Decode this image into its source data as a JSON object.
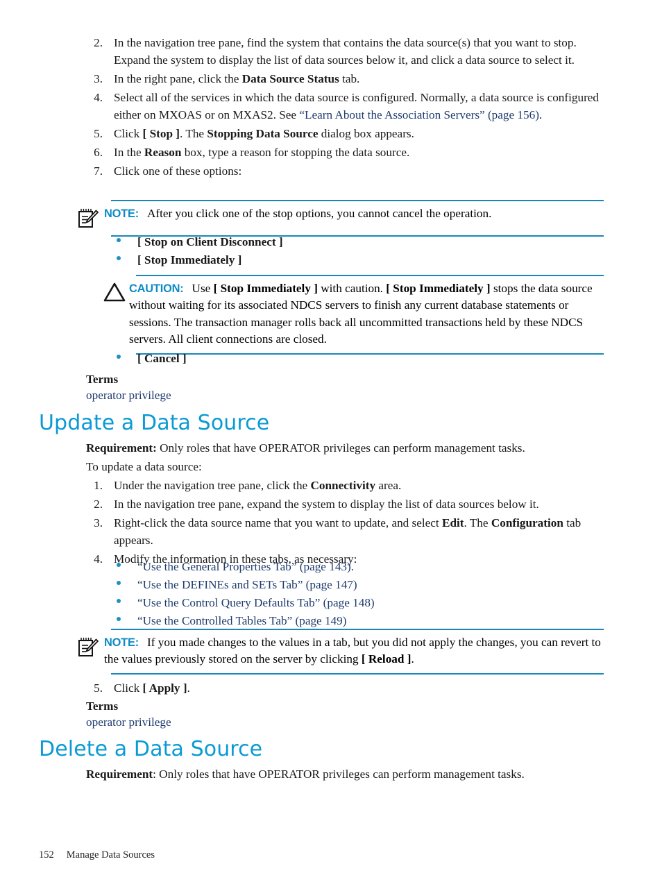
{
  "document": {
    "footer": {
      "page_number": "152",
      "chapter_title": "Manage Data Sources"
    }
  },
  "colors": {
    "heading": "#0b9ad4",
    "admonition_label": "#0c8bc6",
    "rule": "#1b87b8",
    "bullet": "#1c8fc4",
    "link": "#1f3c6e"
  },
  "stop_procedure": {
    "steps": [
      {
        "num": "2.",
        "parts": [
          {
            "text": "In the navigation tree pane, find the system that contains the data source(s) that you want to stop. Expand the system to display the list of data sources below it, and click a data source to select it.",
            "style": "plain"
          }
        ]
      },
      {
        "num": "3.",
        "parts": [
          {
            "text": "In the right pane, click the ",
            "style": "plain"
          },
          {
            "text": "Data Source Status",
            "style": "bold"
          },
          {
            "text": " tab.",
            "style": "plain"
          }
        ]
      },
      {
        "num": "4.",
        "parts": [
          {
            "text": "Select all of the services in which the data source is configured. Normally, a data source is configured either on MXOAS or on MXAS2. See ",
            "style": "plain"
          },
          {
            "text": "“Learn About the Association Servers” (page 156)",
            "style": "link"
          },
          {
            "text": ".",
            "style": "plain"
          }
        ]
      },
      {
        "num": "5.",
        "parts": [
          {
            "text": "Click ",
            "style": "plain"
          },
          {
            "text": "[ Stop ]",
            "style": "bold"
          },
          {
            "text": ". The ",
            "style": "plain"
          },
          {
            "text": "Stopping Data Source",
            "style": "bold"
          },
          {
            "text": " dialog box appears.",
            "style": "plain"
          }
        ]
      },
      {
        "num": "6.",
        "parts": [
          {
            "text": "In the ",
            "style": "plain"
          },
          {
            "text": "Reason",
            "style": "bold"
          },
          {
            "text": " box, type a reason for stopping the data source.",
            "style": "plain"
          }
        ]
      },
      {
        "num": "7.",
        "parts": [
          {
            "text": "Click one of these options:",
            "style": "plain"
          }
        ]
      }
    ],
    "note": {
      "icon": "note-pencil-icon",
      "label": "NOTE:",
      "text": "After you click one of the stop options, you cannot cancel the operation."
    },
    "stop_options": [
      "[ Stop on Client Disconnect ]",
      "[ Stop Immediately ]"
    ],
    "caution": {
      "icon": "caution-triangle-icon",
      "label": "CAUTION:",
      "parts": [
        {
          "text": "Use ",
          "style": "plain"
        },
        {
          "text": "[ Stop Immediately ]",
          "style": "bold"
        },
        {
          "text": " with caution. ",
          "style": "plain"
        },
        {
          "text": "[ Stop Immediately ]",
          "style": "bold"
        },
        {
          "text": " stops the data source without waiting for its associated NDCS servers to finish any current database statements or sessions. The transaction manager rolls back all uncommitted transactions held by these NDCS servers. All client connections are closed.",
          "style": "plain"
        }
      ]
    },
    "cancel_option": "[ Cancel ]",
    "terms_label": "Terms",
    "terms_link": "operator privilege"
  },
  "update_section": {
    "heading": "Update a Data Source",
    "requirement_label": "Requirement:",
    "requirement_text": " Only roles that have OPERATOR privileges can perform management tasks.",
    "intro": "To update a data source:",
    "steps": [
      {
        "num": "1.",
        "parts": [
          {
            "text": "Under the navigation tree pane, click the ",
            "style": "plain"
          },
          {
            "text": "Connectivity",
            "style": "bold"
          },
          {
            "text": " area.",
            "style": "plain"
          }
        ]
      },
      {
        "num": "2.",
        "parts": [
          {
            "text": "In the navigation tree pane, expand the system to display the list of data sources below it.",
            "style": "plain"
          }
        ]
      },
      {
        "num": "3.",
        "parts": [
          {
            "text": "Right-click the data source name that you want to update, and select ",
            "style": "plain"
          },
          {
            "text": "Edit",
            "style": "bold"
          },
          {
            "text": ". The ",
            "style": "plain"
          },
          {
            "text": "Configuration",
            "style": "bold"
          },
          {
            "text": " tab appears.",
            "style": "plain"
          }
        ]
      },
      {
        "num": "4.",
        "parts": [
          {
            "text": "Modify the information in these tabs, as necessary:",
            "style": "plain"
          }
        ]
      }
    ],
    "tab_links": [
      "“Use the General Properties Tab” (page 143).",
      "“Use the DEFINEs and SETs Tab” (page 147)",
      "“Use the Control Query Defaults Tab” (page 148)",
      "“Use the Controlled Tables Tab” (page 149)"
    ],
    "note": {
      "icon": "note-pencil-icon",
      "label": "NOTE:",
      "parts": [
        {
          "text": "If you made changes to the values in a tab, but you did not apply the changes, you can revert to the values previously stored on the server by clicking ",
          "style": "plain"
        },
        {
          "text": "[ Reload ]",
          "style": "bold"
        },
        {
          "text": ".",
          "style": "plain"
        }
      ]
    },
    "final_step": {
      "num": "5.",
      "parts": [
        {
          "text": "Click ",
          "style": "plain"
        },
        {
          "text": "[ Apply ]",
          "style": "bold"
        },
        {
          "text": ".",
          "style": "plain"
        }
      ]
    },
    "terms_label": "Terms",
    "terms_link": "operator privilege"
  },
  "delete_section": {
    "heading": "Delete a Data Source",
    "requirement_label": "Requirement",
    "requirement_text": ": Only roles that have OPERATOR privileges can perform management tasks."
  }
}
